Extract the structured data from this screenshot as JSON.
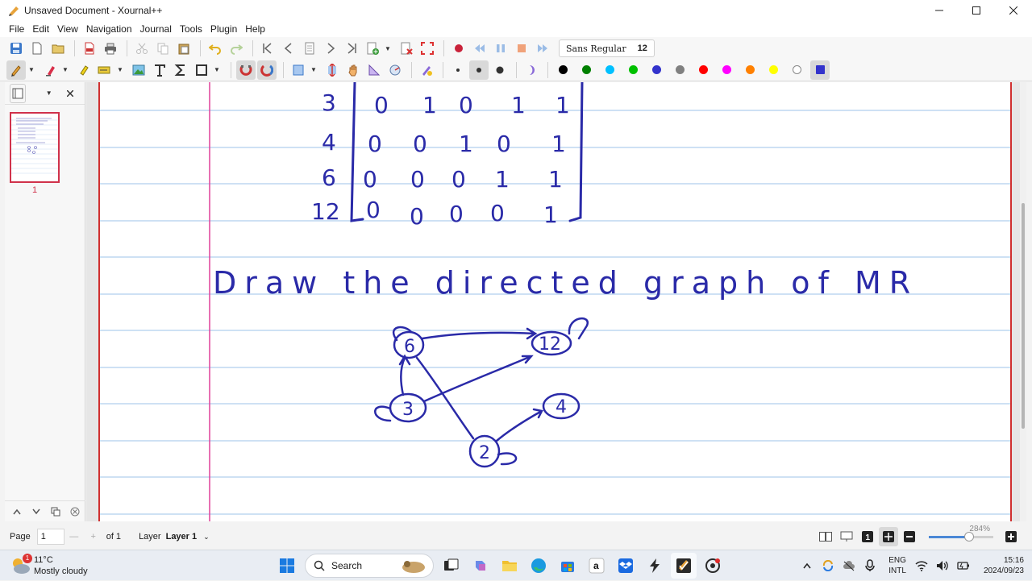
{
  "window": {
    "title": "Unsaved Document - Xournal++"
  },
  "menu": [
    "File",
    "Edit",
    "View",
    "Navigation",
    "Journal",
    "Tools",
    "Plugin",
    "Help"
  ],
  "toolbar": {
    "font_name": "Sans Regular",
    "font_size": "12"
  },
  "palette": [
    "#000000",
    "#008000",
    "#00c0ff",
    "#00c000",
    "#3333cc",
    "#808080",
    "#ff0000",
    "#ff00ff",
    "#ff8000",
    "#ffff00",
    "#ffffff",
    "#3333cc"
  ],
  "sidebar": {
    "page_number": "1"
  },
  "page": {
    "matrix_rows": [
      {
        "label": "3",
        "values": [
          "0",
          "1",
          "0",
          "1",
          "1"
        ]
      },
      {
        "label": "4",
        "values": [
          "0",
          "0",
          "1",
          "0",
          "1"
        ]
      },
      {
        "label": "6",
        "values": [
          "0",
          "0",
          "0",
          "1",
          "1"
        ]
      },
      {
        "label": "12",
        "values": [
          "0",
          "0",
          "0",
          "0",
          "1"
        ]
      }
    ],
    "heading": "Draw the directed graph of MR",
    "graph_nodes": [
      "6",
      "12",
      "3",
      "4",
      "2"
    ]
  },
  "statusbar": {
    "page_label": "Page",
    "page_value": "1",
    "of_label": "of 1",
    "layer_label": "Layer",
    "layer_value": "Layer 1",
    "zoom": "284%"
  },
  "taskbar": {
    "weather_badge": "1",
    "temperature": "11°C",
    "weather": "Mostly cloudy",
    "search_label": "Search",
    "lang_line1": "ENG",
    "lang_line2": "INTL",
    "time": "15:16",
    "date": "2024/09/23"
  },
  "ink_color": "#2a2aa8"
}
